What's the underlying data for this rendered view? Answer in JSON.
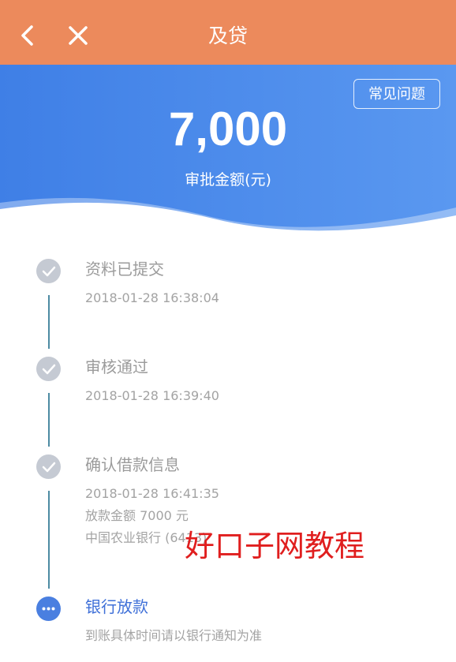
{
  "navbar": {
    "title": "及贷",
    "back_icon": "chevron-left-icon",
    "close_icon": "close-icon",
    "background": "#ec8a5c"
  },
  "hero": {
    "faq_button": "常见问题",
    "amount": "7,000",
    "amount_label": "审批金额(元)",
    "gradient_start": "#3f7fe6",
    "gradient_end": "#5a98f0"
  },
  "timeline": {
    "steps": [
      {
        "title": "资料已提交",
        "lines": [
          "2018-01-28 16:38:04"
        ],
        "status": "done",
        "icon": "check-icon"
      },
      {
        "title": "审核通过",
        "lines": [
          "2018-01-28 16:39:40"
        ],
        "status": "done",
        "icon": "check-icon"
      },
      {
        "title": "确认借款信息",
        "lines": [
          "2018-01-28 16:41:35",
          "放款金额 7000 元",
          "中国农业银行 (6413)"
        ],
        "status": "done",
        "icon": "check-icon"
      },
      {
        "title": "银行放款",
        "lines": [
          "到账具体时间请以银行通知为准"
        ],
        "status": "active",
        "icon": "more-dots-icon"
      }
    ],
    "line_color": "#4d8ba3",
    "done_color": "#c5cad3",
    "active_color": "#4a7fe0"
  },
  "watermark": "好口子网教程"
}
